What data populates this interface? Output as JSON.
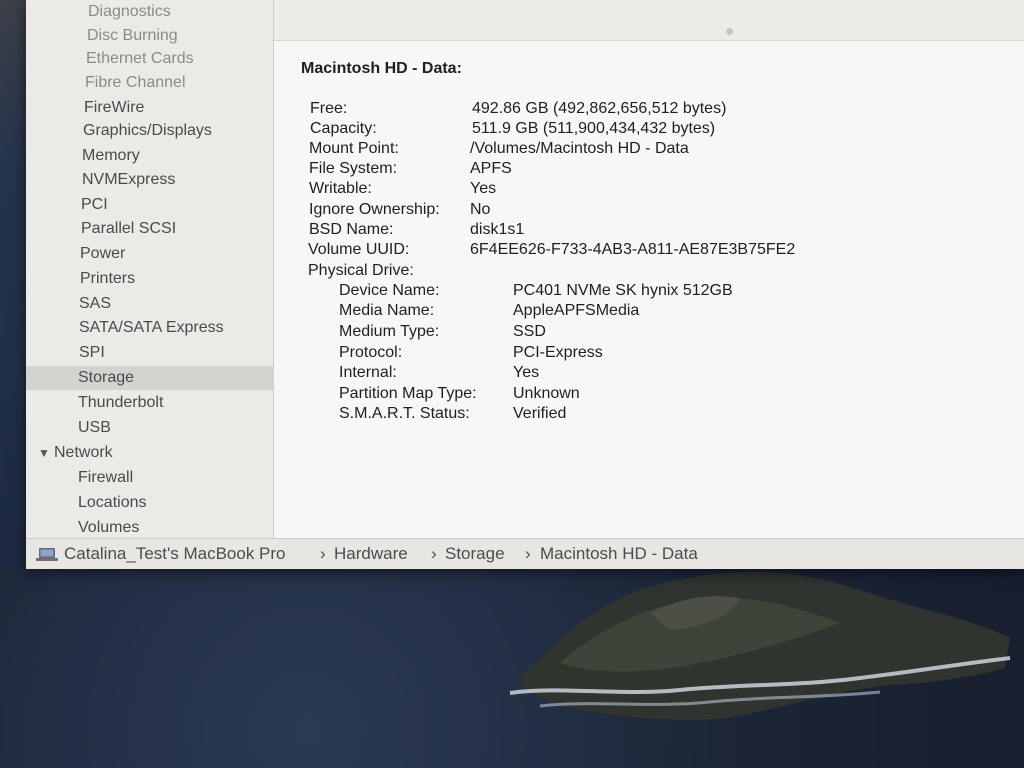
{
  "sidebar": {
    "items": [
      {
        "label": "Diagnostics"
      },
      {
        "label": "Disc Burning"
      },
      {
        "label": "Ethernet Cards"
      },
      {
        "label": "Fibre Channel"
      },
      {
        "label": "FireWire"
      },
      {
        "label": "Graphics/Displays"
      },
      {
        "label": "Memory"
      },
      {
        "label": "NVMExpress"
      },
      {
        "label": "PCI"
      },
      {
        "label": "Parallel SCSI"
      },
      {
        "label": "Power"
      },
      {
        "label": "Printers"
      },
      {
        "label": "SAS"
      },
      {
        "label": "SATA/SATA Express"
      },
      {
        "label": "SPI"
      },
      {
        "label": "Storage",
        "selected": true
      },
      {
        "label": "Thunderbolt"
      },
      {
        "label": "USB"
      },
      {
        "label": "Network",
        "group": true
      },
      {
        "label": "Firewall"
      },
      {
        "label": "Locations"
      },
      {
        "label": "Volumes"
      }
    ]
  },
  "detail": {
    "title": "Macintosh HD - Data:",
    "fields": [
      {
        "key": "Free:",
        "value": "492.86 GB (492,862,656,512 bytes)"
      },
      {
        "key": "Capacity:",
        "value": "511.9 GB (511,900,434,432 bytes)"
      },
      {
        "key": "Mount Point:",
        "value": "/Volumes/Macintosh HD - Data"
      },
      {
        "key": "File System:",
        "value": "APFS"
      },
      {
        "key": "Writable:",
        "value": "Yes"
      },
      {
        "key": "Ignore Ownership:",
        "value": "No"
      },
      {
        "key": "BSD Name:",
        "value": "disk1s1"
      },
      {
        "key": "Volume UUID:",
        "value": "6F4EE626-F733-4AB3-A811-AE87E3B75FE2"
      },
      {
        "key": "Physical Drive:",
        "value": ""
      }
    ],
    "physical_drive": [
      {
        "key": "Device Name:",
        "value": "PC401 NVMe SK hynix 512GB"
      },
      {
        "key": "Media Name:",
        "value": "AppleAPFSMedia"
      },
      {
        "key": "Medium Type:",
        "value": "SSD"
      },
      {
        "key": "Protocol:",
        "value": "PCI-Express"
      },
      {
        "key": "Internal:",
        "value": "Yes"
      },
      {
        "key": "Partition Map Type:",
        "value": "Unknown"
      },
      {
        "key": "S.M.A.R.T. Status:",
        "value": "Verified"
      }
    ]
  },
  "pathbar": {
    "segments": [
      "Catalina_Test's MacBook Pro",
      "Hardware",
      "Storage",
      "Macintosh HD - Data"
    ],
    "separator": "›",
    "icon": "laptop-icon"
  },
  "colors": {
    "window_bg": "#f2f1ef",
    "sidebar_bg": "#ebeae7",
    "selected_row": "#d4d3d0",
    "text": "#1f1f1f"
  }
}
